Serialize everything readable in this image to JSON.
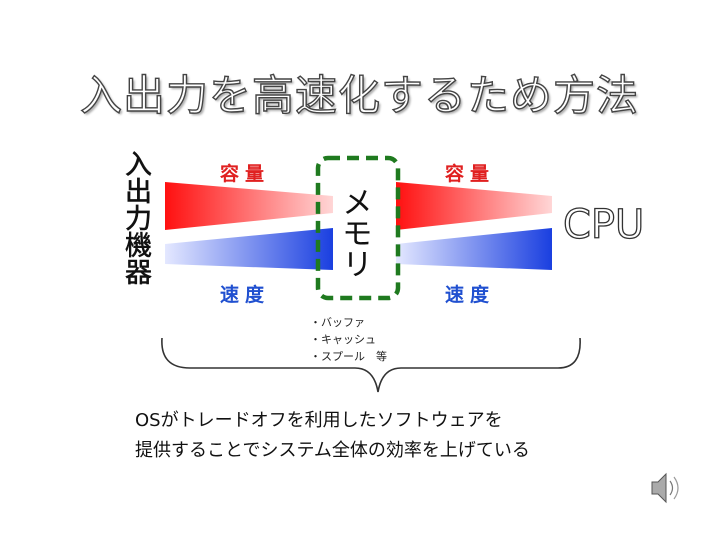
{
  "title": "入出力を高速化するため方法",
  "left_device_label": "入出力機器",
  "right_device_label": "CPU",
  "capacity_label": "容量",
  "speed_label": "速度",
  "memory_label": "メモリ",
  "examples": [
    "・バッファ",
    "・キャッシュ",
    "・スプール　等"
  ],
  "note_lines": [
    "OSがトレードオフを利用したソフトウェアを",
    "提供することでシステム全体の効率を上げている"
  ],
  "colors": {
    "capacity": "#ff2020",
    "speed": "#2050e0",
    "memory_box": "#1f7a1f"
  },
  "icons": {
    "speaker": "speaker-icon"
  }
}
